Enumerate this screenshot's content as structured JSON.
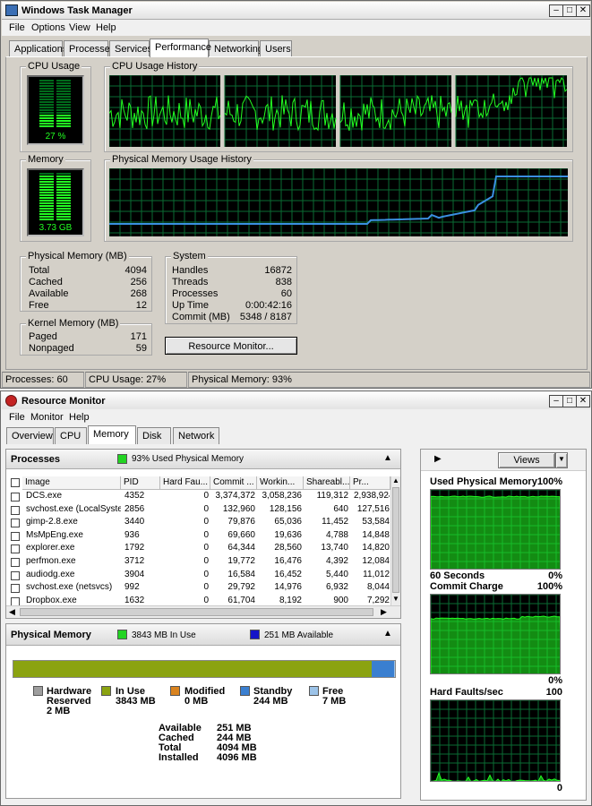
{
  "task_manager": {
    "title": "Windows Task Manager",
    "menu": [
      "File",
      "Options",
      "View",
      "Help"
    ],
    "tabs": [
      "Applications",
      "Processes",
      "Services",
      "Performance",
      "Networking",
      "Users"
    ],
    "selected_tab": "Performance",
    "cpu_usage_label": "CPU Usage",
    "cpu_usage_value": "27 %",
    "cpu_usage_fraction": 0.27,
    "cpu_history_label": "CPU Usage History",
    "memory_label": "Memory",
    "memory_value": "3.73 GB",
    "memory_fraction": 0.93,
    "pm_history_label": "Physical Memory Usage History",
    "physical_memory": {
      "header": "Physical Memory (MB)",
      "rows": [
        {
          "label": "Total",
          "value": "4094"
        },
        {
          "label": "Cached",
          "value": "256"
        },
        {
          "label": "Available",
          "value": "268"
        },
        {
          "label": "Free",
          "value": "12"
        }
      ]
    },
    "kernel_memory": {
      "header": "Kernel Memory (MB)",
      "rows": [
        {
          "label": "Paged",
          "value": "171"
        },
        {
          "label": "Nonpaged",
          "value": "59"
        }
      ]
    },
    "system": {
      "header": "System",
      "rows": [
        {
          "label": "Handles",
          "value": "16872"
        },
        {
          "label": "Threads",
          "value": "838"
        },
        {
          "label": "Processes",
          "value": "60"
        },
        {
          "label": "Up Time",
          "value": "0:00:42:16"
        },
        {
          "label": "Commit (MB)",
          "value": "5348 / 8187"
        }
      ]
    },
    "resource_monitor_button": "Resource Monitor...",
    "status": {
      "processes": "Processes: 60",
      "cpu": "CPU Usage: 27%",
      "memory": "Physical Memory: 93%"
    }
  },
  "resource_monitor": {
    "title": "Resource Monitor",
    "menu": [
      "File",
      "Monitor",
      "Help"
    ],
    "tabs": [
      "Overview",
      "CPU",
      "Memory",
      "Disk",
      "Network"
    ],
    "selected_tab": "Memory",
    "processes": {
      "title": "Processes",
      "badge": "93% Used Physical Memory",
      "columns": [
        "Image",
        "PID",
        "Hard Fau...",
        "Commit ...",
        "Workin...",
        "Shareabl...",
        "Pr..."
      ],
      "rows": [
        [
          "DCS.exe",
          "4352",
          "0",
          "3,374,372",
          "3,058,236",
          "119,312",
          "2,938,924"
        ],
        [
          "svchost.exe (LocalSyste...",
          "2856",
          "0",
          "132,960",
          "128,156",
          "640",
          "127,516"
        ],
        [
          "gimp-2.8.exe",
          "3440",
          "0",
          "79,876",
          "65,036",
          "11,452",
          "53,584"
        ],
        [
          "MsMpEng.exe",
          "936",
          "0",
          "69,660",
          "19,636",
          "4,788",
          "14,848"
        ],
        [
          "explorer.exe",
          "1792",
          "0",
          "64,344",
          "28,560",
          "13,740",
          "14,820"
        ],
        [
          "perfmon.exe",
          "3712",
          "0",
          "19,772",
          "16,476",
          "4,392",
          "12,084"
        ],
        [
          "audiodg.exe",
          "3904",
          "0",
          "16,584",
          "16,452",
          "5,440",
          "11,012"
        ],
        [
          "svchost.exe (netsvcs)",
          "992",
          "0",
          "29,792",
          "14,976",
          "6,932",
          "8,044"
        ],
        [
          "Dropbox.exe",
          "1632",
          "0",
          "61,704",
          "8,192",
          "900",
          "7,292"
        ]
      ]
    },
    "physical_memory": {
      "title": "Physical Memory",
      "in_use_badge": "3843 MB In Use",
      "available_badge": "251 MB Available",
      "bar": {
        "hardware_reserved": 2,
        "in_use": 3843,
        "modified": 0,
        "standby": 244,
        "free": 7,
        "total": 4096
      },
      "legend": [
        {
          "name": "Hardware Reserved",
          "line1": "Hardware",
          "line2": "Reserved",
          "value": "2 MB",
          "color": "#9e9e9e"
        },
        {
          "name": "In Use",
          "line1": "In Use",
          "line2": "",
          "value": "3843 MB",
          "color": "#8ba311"
        },
        {
          "name": "Modified",
          "line1": "Modified",
          "line2": "",
          "value": "0 MB",
          "color": "#d9831f"
        },
        {
          "name": "Standby",
          "line1": "Standby",
          "line2": "",
          "value": "244 MB",
          "color": "#3a7fd0"
        },
        {
          "name": "Free",
          "line1": "Free",
          "line2": "",
          "value": "7 MB",
          "color": "#9cc3e8"
        }
      ],
      "summary": [
        {
          "label": "Available",
          "value": "251 MB"
        },
        {
          "label": "Cached",
          "value": "244 MB"
        },
        {
          "label": "Total",
          "value": "4094 MB"
        },
        {
          "label": "Installed",
          "value": "4096 MB"
        }
      ]
    },
    "right_panel": {
      "views_button": "Views",
      "graphs": [
        {
          "title": "Used Physical Memory",
          "top_value": "100%",
          "footer_left": "60 Seconds",
          "footer_right": "0%"
        },
        {
          "title": "Commit Charge",
          "top_value": "100%",
          "footer_left": "",
          "footer_right": "0%"
        },
        {
          "title": "Hard Faults/sec",
          "top_value": "100",
          "footer_left": "",
          "footer_right": "0"
        }
      ]
    }
  }
}
